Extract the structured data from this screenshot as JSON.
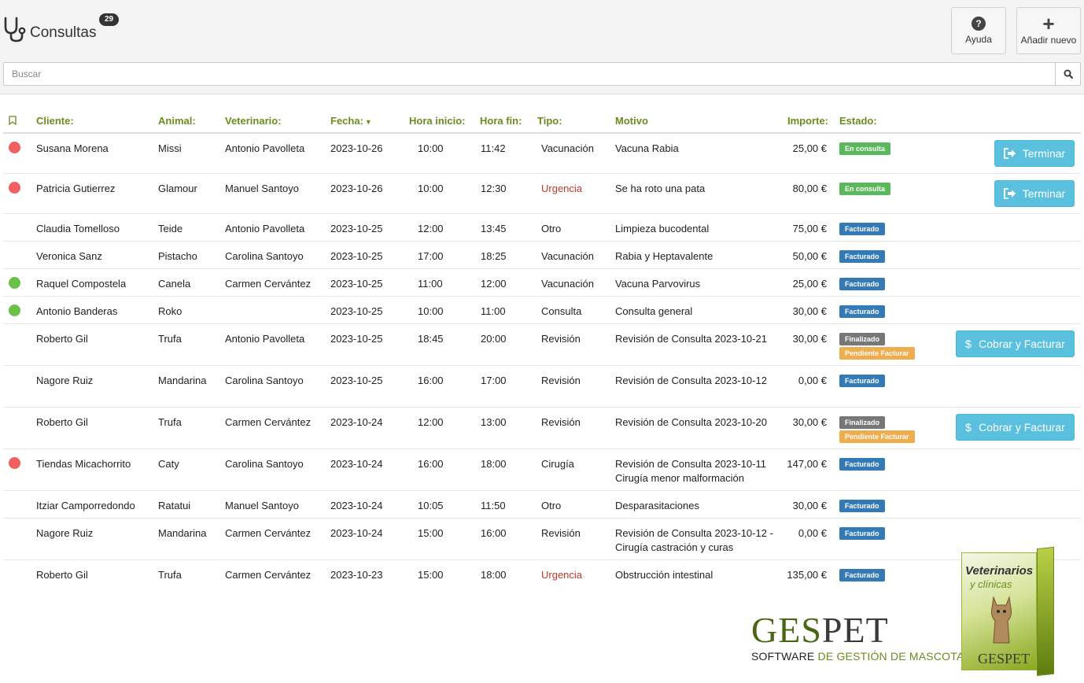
{
  "header": {
    "title": "Consultas",
    "count": "29",
    "help_label": "Ayuda",
    "add_label": "Añadir nuevo"
  },
  "search": {
    "placeholder": "Buscar",
    "value": ""
  },
  "table": {
    "columns": {
      "cliente": "Cliente:",
      "animal": "Animal:",
      "veterinario": "Veterinario:",
      "fecha": "Fecha:",
      "hora_inicio": "Hora inicio:",
      "hora_fin": "Hora fin:",
      "tipo": "Tipo:",
      "motivo": "Motivo",
      "importe": "Importe:",
      "estado": "Estado:"
    },
    "rows": [
      {
        "dot": "red",
        "cliente": "Susana Morena",
        "animal": "Missi",
        "veterinario": "Antonio Pavolleta",
        "fecha": "2023-10-26",
        "hora_inicio": "10:00",
        "hora_fin": "11:42",
        "tipo": "Vacunación",
        "tipo_urgent": false,
        "motivo": "Vacuna Rabia",
        "motivo2": "",
        "importe": "25,00 €",
        "estados": [
          {
            "label": "En consulta",
            "kind": "consulta"
          }
        ],
        "action": "Terminar"
      },
      {
        "dot": "red",
        "cliente": "Patricia Gutierrez",
        "animal": "Glamour",
        "veterinario": "Manuel Santoyo",
        "fecha": "2023-10-26",
        "hora_inicio": "10:00",
        "hora_fin": "12:30",
        "tipo": "Urgencia",
        "tipo_urgent": true,
        "motivo": "Se ha roto una pata",
        "motivo2": "",
        "importe": "80,00 €",
        "estados": [
          {
            "label": "En consulta",
            "kind": "consulta"
          }
        ],
        "action": "Terminar"
      },
      {
        "dot": "",
        "cliente": "Claudia Tomelloso",
        "animal": "Teide",
        "veterinario": "Antonio Pavolleta",
        "fecha": "2023-10-25",
        "hora_inicio": "12:00",
        "hora_fin": "13:45",
        "tipo": "Otro",
        "tipo_urgent": false,
        "motivo": "Limpieza bucodental",
        "motivo2": "",
        "importe": "75,00 €",
        "estados": [
          {
            "label": "Facturado",
            "kind": "facturado"
          }
        ],
        "action": ""
      },
      {
        "dot": "",
        "cliente": "Veronica Sanz",
        "animal": "Pistacho",
        "veterinario": "Carolina Santoyo",
        "fecha": "2023-10-25",
        "hora_inicio": "17:00",
        "hora_fin": "18:25",
        "tipo": "Vacunación",
        "tipo_urgent": false,
        "motivo": "Rabia y Heptavalente",
        "motivo2": "",
        "importe": "50,00 €",
        "estados": [
          {
            "label": "Facturado",
            "kind": "facturado"
          }
        ],
        "action": ""
      },
      {
        "dot": "green",
        "cliente": "Raquel Compostela",
        "animal": "Canela",
        "veterinario": "Carmen Cervántez",
        "fecha": "2023-10-25",
        "hora_inicio": "11:00",
        "hora_fin": "12:00",
        "tipo": "Vacunación",
        "tipo_urgent": false,
        "motivo": "Vacuna Parvovirus",
        "motivo2": "",
        "importe": "25,00 €",
        "estados": [
          {
            "label": "Facturado",
            "kind": "facturado"
          }
        ],
        "action": ""
      },
      {
        "dot": "green",
        "cliente": "Antonio Banderas",
        "animal": "Roko",
        "veterinario": "",
        "fecha": "2023-10-25",
        "hora_inicio": "10:00",
        "hora_fin": "11:00",
        "tipo": "Consulta",
        "tipo_urgent": false,
        "motivo": "Consulta general",
        "motivo2": "",
        "importe": "30,00 €",
        "estados": [
          {
            "label": "Facturado",
            "kind": "facturado"
          }
        ],
        "action": ""
      },
      {
        "dot": "",
        "cliente": "Roberto Gil",
        "animal": "Trufa",
        "veterinario": "Antonio Pavolleta",
        "fecha": "2023-10-25",
        "hora_inicio": "18:45",
        "hora_fin": "20:00",
        "tipo": "Revisión",
        "tipo_urgent": false,
        "motivo": "Revisión de Consulta 2023-10-21",
        "motivo2": "",
        "importe": "30,00 €",
        "estados": [
          {
            "label": "Finalizado",
            "kind": "finalizado"
          },
          {
            "label": "Pendiente Facturar",
            "kind": "pendiente"
          }
        ],
        "action": "Cobrar y Facturar"
      },
      {
        "dot": "",
        "cliente": "Nagore Ruiz",
        "animal": "Mandarina",
        "veterinario": "Carolina Santoyo",
        "fecha": "2023-10-25",
        "hora_inicio": "16:00",
        "hora_fin": "17:00",
        "tipo": "Revisión",
        "tipo_urgent": false,
        "motivo": "Revisión de Consulta 2023-10-12",
        "motivo2": "",
        "importe": "0,00 €",
        "estados": [
          {
            "label": "Facturado",
            "kind": "facturado"
          }
        ],
        "action": ""
      },
      {
        "dot": "",
        "cliente": "Roberto Gil",
        "animal": "Trufa",
        "veterinario": "Carmen Cervántez",
        "fecha": "2023-10-24",
        "hora_inicio": "12:00",
        "hora_fin": "13:00",
        "tipo": "Revisión",
        "tipo_urgent": false,
        "motivo": "Revisión de Consulta 2023-10-20",
        "motivo2": "",
        "importe": "30,00 €",
        "estados": [
          {
            "label": "Finalizado",
            "kind": "finalizado"
          },
          {
            "label": "Pendiente Facturar",
            "kind": "pendiente"
          }
        ],
        "action": "Cobrar y Facturar"
      },
      {
        "dot": "red",
        "cliente": "Tiendas Micachorrito",
        "animal": "Caty",
        "veterinario": "Carolina Santoyo",
        "fecha": "2023-10-24",
        "hora_inicio": "16:00",
        "hora_fin": "18:00",
        "tipo": "Cirugía",
        "tipo_urgent": false,
        "motivo": "Revisión de Consulta 2023-10-11",
        "motivo2": "Cirugía menor malformación",
        "importe": "147,00 €",
        "estados": [
          {
            "label": "Facturado",
            "kind": "facturado"
          }
        ],
        "action": ""
      },
      {
        "dot": "",
        "cliente": "Itziar Camporredondo",
        "animal": "Ratatui",
        "veterinario": "Manuel Santoyo",
        "fecha": "2023-10-24",
        "hora_inicio": "10:05",
        "hora_fin": "11:50",
        "tipo": "Otro",
        "tipo_urgent": false,
        "motivo": "Desparasitaciones",
        "motivo2": "",
        "importe": "30,00 €",
        "estados": [
          {
            "label": "Facturado",
            "kind": "facturado"
          }
        ],
        "action": ""
      },
      {
        "dot": "",
        "cliente": "Nagore Ruiz",
        "animal": "Mandarina",
        "veterinario": "Carmen Cervántez",
        "fecha": "2023-10-24",
        "hora_inicio": "15:00",
        "hora_fin": "16:00",
        "tipo": "Revisión",
        "tipo_urgent": false,
        "motivo": "Revisión de Consulta 2023-10-12 -",
        "motivo2": "Cirugía castración y curas",
        "importe": "0,00 €",
        "estados": [
          {
            "label": "Facturado",
            "kind": "facturado"
          }
        ],
        "action": ""
      },
      {
        "dot": "",
        "cliente": "Roberto Gil",
        "animal": "Trufa",
        "veterinario": "Carmen Cervántez",
        "fecha": "2023-10-23",
        "hora_inicio": "15:00",
        "hora_fin": "18:00",
        "tipo": "Urgencia",
        "tipo_urgent": true,
        "motivo": "Obstrucción intestinal",
        "motivo2": "",
        "importe": "135,00 €",
        "estados": [
          {
            "label": "Facturado",
            "kind": "facturado"
          }
        ],
        "action": ""
      }
    ]
  },
  "logo": {
    "word1": "GES",
    "word2": "PET",
    "tag1": "SOFTWARE ",
    "tag2": "DE GESTIÓN DE MASCOTAS",
    "box_title": "Veterinarios",
    "box_subtitle": "y clínicas",
    "box_brand": "GESPET"
  },
  "colors": {
    "header_text": "#6b8c1f",
    "dot_red": "#f06060",
    "dot_green": "#6cc04a",
    "urgent": "#c0392b",
    "button": "#5bc0de"
  }
}
